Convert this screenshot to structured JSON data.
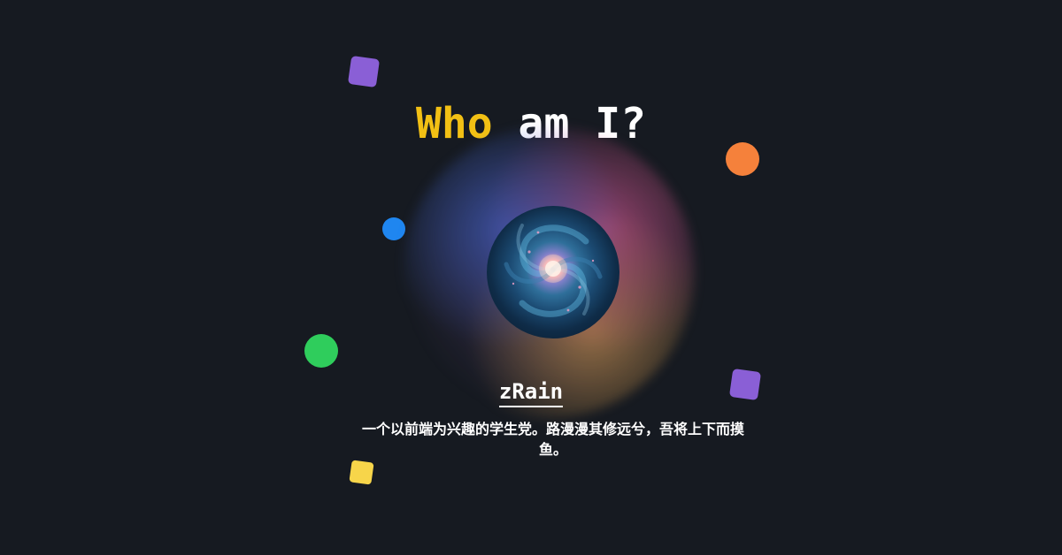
{
  "title": {
    "highlight": "Who",
    "rest": " am I?"
  },
  "avatar": {
    "icon": "galaxy-avatar"
  },
  "profile": {
    "name": "zRain",
    "bio": "一个以前端为兴趣的学生党。路漫漫其修远兮，吾将上下而摸鱼。"
  },
  "colors": {
    "background": "#161a21",
    "title_highlight": "#f2c014",
    "shape_purple": "#8a5fd6",
    "shape_orange": "#f5813b",
    "shape_blue": "#1f86f0",
    "shape_green": "#2fcd5c",
    "shape_yellow": "#f7d54a"
  },
  "decorations": [
    {
      "name": "purple-square",
      "color": "#8a5fd6"
    },
    {
      "name": "orange-circle",
      "color": "#f5813b"
    },
    {
      "name": "blue-circle",
      "color": "#1f86f0"
    },
    {
      "name": "green-circle",
      "color": "#2fcd5c"
    },
    {
      "name": "purple-square",
      "color": "#8a5fd6"
    },
    {
      "name": "yellow-square",
      "color": "#f7d54a"
    }
  ]
}
